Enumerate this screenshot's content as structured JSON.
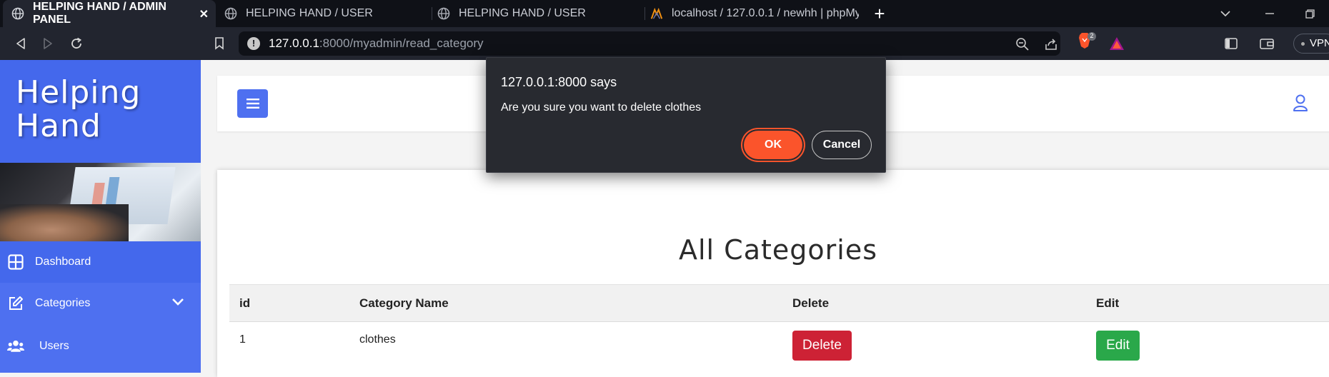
{
  "browser": {
    "tabs": [
      {
        "title": "HELPING HAND / ADMIN PANEL",
        "active": true,
        "favicon": "globe-icon"
      },
      {
        "title": "HELPING HAND / USER",
        "active": false,
        "favicon": "globe-icon"
      },
      {
        "title": "HELPING HAND / USER",
        "active": false,
        "favicon": "globe-icon"
      },
      {
        "title": "localhost / 127.0.0.1 / newhh | phpMy",
        "active": false,
        "favicon": "phpmyadmin-icon"
      }
    ],
    "url_host": "127.0.0.1",
    "url_rest": ":8000/myadmin/read_category",
    "shield_count": "2",
    "vpn_label": "VPN"
  },
  "sidebar": {
    "brand_line1": "Helping",
    "brand_line2": "Hand",
    "items": [
      {
        "label": "Dashboard",
        "icon": "dashboard-grid-icon"
      },
      {
        "label": "Categories",
        "icon": "edit-icon"
      },
      {
        "label": "Users",
        "icon": "users-icon"
      }
    ]
  },
  "main": {
    "title": "All Categories",
    "columns": [
      "id",
      "Category Name",
      "Delete",
      "Edit"
    ],
    "rows": [
      {
        "id": "1",
        "name": "clothes",
        "delete_label": "Delete",
        "edit_label": "Edit"
      }
    ]
  },
  "dialog": {
    "title": "127.0.0.1:8000 says",
    "message": "Are you sure you want to delete clothes",
    "ok_label": "OK",
    "cancel_label": "Cancel"
  },
  "colors": {
    "sidebar": "#4e70f0",
    "ok_button": "#fb542b",
    "delete_button": "#cd2235",
    "edit_button": "#2aa84a"
  }
}
